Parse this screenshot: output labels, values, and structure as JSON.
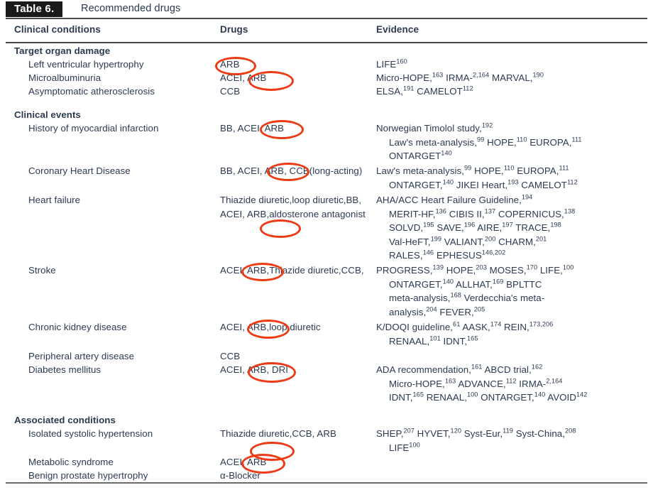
{
  "caption": {
    "tag": "Table 6.",
    "title": "Recommended drugs"
  },
  "columns": {
    "conditions": "Clinical conditions",
    "drugs": "Drugs",
    "evidence": "Evidence"
  },
  "groups": [
    {
      "name": "Target organ damage",
      "rows": [
        {
          "condition": "Left ventricular hypertrophy",
          "drugs": "ARB",
          "evidence": "LIFE160"
        },
        {
          "condition": "Microalbuminuria",
          "drugs": "ACEI, ARB",
          "evidence": "Micro-HOPE,163 IRMA-2,164 MARVAL,190"
        },
        {
          "condition": "Asymptomatic atherosclerosis",
          "drugs": "CCB",
          "evidence": "ELSA,191 CAMELOT112"
        }
      ]
    },
    {
      "name": "Clinical events",
      "rows": [
        {
          "condition": "History of myocardial infarction",
          "drugs": "BB, ACEI, ARB",
          "evidence": "Norwegian Timolol study,192 Law's meta-analysis,99 HOPE,110 EUROPA,111 ONTARGET140"
        },
        {
          "condition": "Coronary Heart Disease",
          "drugs": "BB, ACEI, ARB, CCB (long-acting)",
          "evidence": "Law's meta-analysis,99 HOPE,110 EUROPA,111 ONTARGET,140 JIKEI Heart,193 CAMELOT112"
        },
        {
          "condition": "Heart failure",
          "drugs": "Thiazide diuretic, loop diuretic, BB, ACEI, ARB, aldosterone antagonist",
          "evidence": "AHA/ACC Heart Failure Guideline,194 MERIT-HF,136 CIBIS II,137 COPERNICUS,138 SOLVD,195 SAVE,196 AIRE,197 TRACE,198 Val-HeFT,199 VALIANT,200 CHARM,201 RALES,146 EPHESUS146,202"
        },
        {
          "condition": "Stroke",
          "drugs": "ACEI, ARB, Thiazide diuretic, CCB,",
          "evidence": "PROGRESS,139 HOPE,203 MOSES,170 LIFE,100 ONTARGET,140 ALLHAT,169 BPLTTC meta-analysis,168 Verdecchia's meta-analysis,204 FEVER,205"
        },
        {
          "condition": "Chronic kidney disease",
          "drugs": "ACEI, ARB, loop diuretic",
          "evidence": "K/DOQI guideline,61 AASK,174 REIN,173,206 RENAAL,101 IDNT,165"
        },
        {
          "condition": "Peripheral artery disease",
          "drugs": "CCB",
          "evidence": ""
        },
        {
          "condition": "Diabetes mellitus",
          "drugs": "ACEI, ARB, DRI",
          "evidence": "ADA recommendation,161 ABCD trial,162 Micro-HOPE,163 ADVANCE,112 IRMA-2,164 IDNT,165 RENAAL,100 ONTARGET,140 AVOID142"
        }
      ]
    },
    {
      "name": "Associated conditions",
      "rows": [
        {
          "condition": "Isolated systolic hypertension",
          "drugs": "Thiazide diuretic, CCB, ARB",
          "evidence": "SHEP,207 HYVET,120 Syst-Eur,119 Syst-China,208 LIFE100"
        },
        {
          "condition": "Metabolic syndrome",
          "drugs": "ACEI, ARB",
          "evidence": ""
        },
        {
          "condition": "Benign prostate hypertrophy",
          "drugs": "α-Blocker",
          "evidence": ""
        }
      ]
    }
  ],
  "annotations": {
    "color": "#ee3a14",
    "description": "hand-drawn red ellipses highlighting ARB mentions",
    "count": 11,
    "targets": [
      "Left ventricular hypertrophy / ARB",
      "Microalbuminuria / ARB",
      "History of myocardial infarction / ARB",
      "Coronary Heart Disease / ARB,",
      "Heart failure / ARB,",
      "Stroke / ARB,",
      "Chronic kidney disease / ARB,",
      "Diabetes mellitus / ARB,",
      "Isolated systolic hypertension / ARB",
      "Metabolic syndrome / ARB",
      "Metabolic syndrome overlap"
    ]
  }
}
